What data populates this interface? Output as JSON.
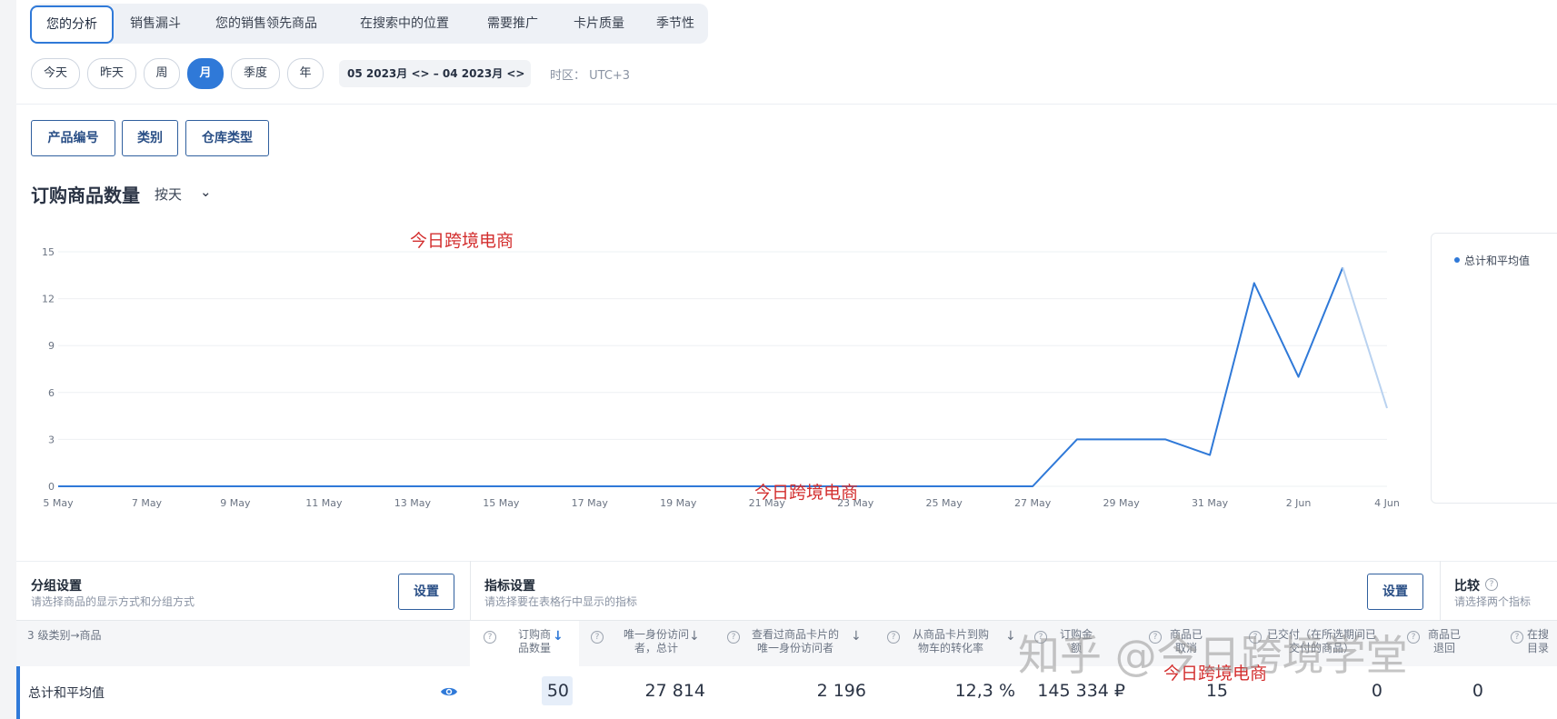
{
  "tabs": [
    "您的分析",
    "销售漏斗",
    "您的销售领先商品",
    "在搜索中的位置",
    "需要推广",
    "卡片质量",
    "季节性"
  ],
  "periods": [
    "今天",
    "昨天",
    "周",
    "月",
    "季度",
    "年"
  ],
  "date_range": "05 2023月 <>  –  04 2023月 <>",
  "timezone": "时区： UTC+3",
  "filters": [
    "产品编号",
    "类别",
    "仓库类型"
  ],
  "chart_header": {
    "title": "订购商品数量",
    "granularity": "按天"
  },
  "legend_label": "总计和平均值",
  "watermarks": {
    "top": "今日跨境电商",
    "middle": "今日跨境电商",
    "table": "今日跨境电商",
    "zhihu": "知乎 @今日跨境学堂"
  },
  "grouping": {
    "title": "分组设置",
    "subtitle": "请选择商品的显示方式和分组方式",
    "button": "设置"
  },
  "metrics": {
    "title": "指标设置",
    "subtitle": "请选择要在表格行中显示的指标",
    "button": "设置"
  },
  "compare": {
    "title": "比较",
    "subtitle": "请选择两个指标"
  },
  "table": {
    "group_header": "3 级类别→商品",
    "headers": [
      "订购商\n品数量",
      "唯一身份访问\n者，总计",
      "查看过商品卡片的\n唯一身份访问者",
      "从商品卡片到购\n物车的转化率",
      "订购金\n额",
      "商品已\n取消",
      "已交付（在所选期间已\n交付的商品）",
      "商品已\n退回",
      "在搜\n目录"
    ],
    "row": {
      "label": "总计和平均值",
      "values": [
        "50",
        "27 814",
        "2 196",
        "12,3 %",
        "145 334 ₽",
        "15",
        "0",
        "0"
      ]
    }
  },
  "chart_data": {
    "type": "line",
    "title": "订购商品数量",
    "x": [
      "5 May",
      "6 May",
      "7 May",
      "8 May",
      "9 May",
      "10 May",
      "11 May",
      "12 May",
      "13 May",
      "14 May",
      "15 May",
      "16 May",
      "17 May",
      "18 May",
      "19 May",
      "20 May",
      "21 May",
      "22 May",
      "23 May",
      "24 May",
      "25 May",
      "26 May",
      "27 May",
      "28 May",
      "29 May",
      "30 May",
      "31 May",
      "1 Jun",
      "2 Jun",
      "3 Jun",
      "4 Jun"
    ],
    "x_tick_labels": [
      "5 May",
      "7 May",
      "9 May",
      "11 May",
      "13 May",
      "15 May",
      "17 May",
      "19 May",
      "21 May",
      "23 May",
      "25 May",
      "27 May",
      "29 May",
      "31 May",
      "2 Jun",
      "4 Jun"
    ],
    "series": [
      {
        "name": "总计和平均值",
        "values": [
          0,
          0,
          0,
          0,
          0,
          0,
          0,
          0,
          0,
          0,
          0,
          0,
          0,
          0,
          0,
          0,
          0,
          0,
          0,
          0,
          0,
          0,
          0,
          3,
          3,
          3,
          2,
          13,
          7,
          14,
          5
        ]
      }
    ],
    "y_ticks": [
      0,
      3,
      6,
      9,
      12,
      15
    ],
    "ylim": [
      0,
      15
    ],
    "grid": true,
    "legend": "right",
    "colors": {
      "line": "#2f79d8",
      "line_partial": "#b9d2f0"
    }
  }
}
